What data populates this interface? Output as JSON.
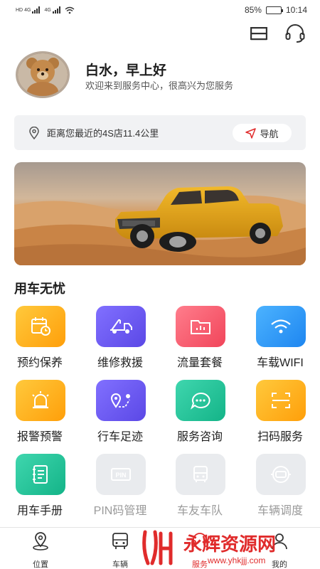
{
  "status_bar": {
    "left_tags": [
      "HD",
      "4G",
      "4G"
    ],
    "battery": "85%",
    "battery_level": 0.85,
    "time": "10:14"
  },
  "header": {
    "menu_icon": "menu-icon",
    "service_icon": "headset-icon"
  },
  "greeting": {
    "title": "白水，早上好",
    "subtitle": "欢迎来到服务中心，很高兴为您服务"
  },
  "distance": {
    "text": "距离您最近的4S店11.4公里",
    "nav_label": "导航"
  },
  "section": {
    "title": "用车无忧"
  },
  "services": [
    {
      "label": "预约保养",
      "icon": "calendar-icon",
      "color": "#ffb21a",
      "enabled": true
    },
    {
      "label": "维修救援",
      "icon": "tow-truck-icon",
      "color": "#6c5cf0",
      "enabled": true
    },
    {
      "label": "流量套餐",
      "icon": "data-folder-icon",
      "color": "#ff5a6c",
      "enabled": true
    },
    {
      "label": "车载WIFI",
      "icon": "wifi-icon",
      "color": "#2f9bfb",
      "enabled": true
    },
    {
      "label": "报警预警",
      "icon": "alarm-light-icon",
      "color": "#ffb21a",
      "enabled": true
    },
    {
      "label": "行车足迹",
      "icon": "route-icon",
      "color": "#6c5cf0",
      "enabled": true
    },
    {
      "label": "服务咨询",
      "icon": "chat-icon",
      "color": "#23c49c",
      "enabled": true
    },
    {
      "label": "扫码服务",
      "icon": "scan-icon",
      "color": "#ffb21a",
      "enabled": true
    },
    {
      "label": "用车手册",
      "icon": "manual-icon",
      "color": "#23c49c",
      "enabled": true
    },
    {
      "label": "PIN码管理",
      "icon": "pin-icon",
      "color": "#e9ebee",
      "enabled": false
    },
    {
      "label": "车友车队",
      "icon": "bus-icon",
      "color": "#e9ebee",
      "enabled": false
    },
    {
      "label": "车辆调度",
      "icon": "dispatch-icon",
      "color": "#e9ebee",
      "enabled": false
    }
  ],
  "tabs": [
    {
      "label": "位置",
      "icon": "location-icon"
    },
    {
      "label": "车辆",
      "icon": "car-icon"
    },
    {
      "label": "服务",
      "icon": "service-icon",
      "active": true
    },
    {
      "label": "我的",
      "icon": "user-icon"
    }
  ],
  "watermark": {
    "text": "永辉资源网",
    "url_text": "www.yhkjjj.com"
  }
}
